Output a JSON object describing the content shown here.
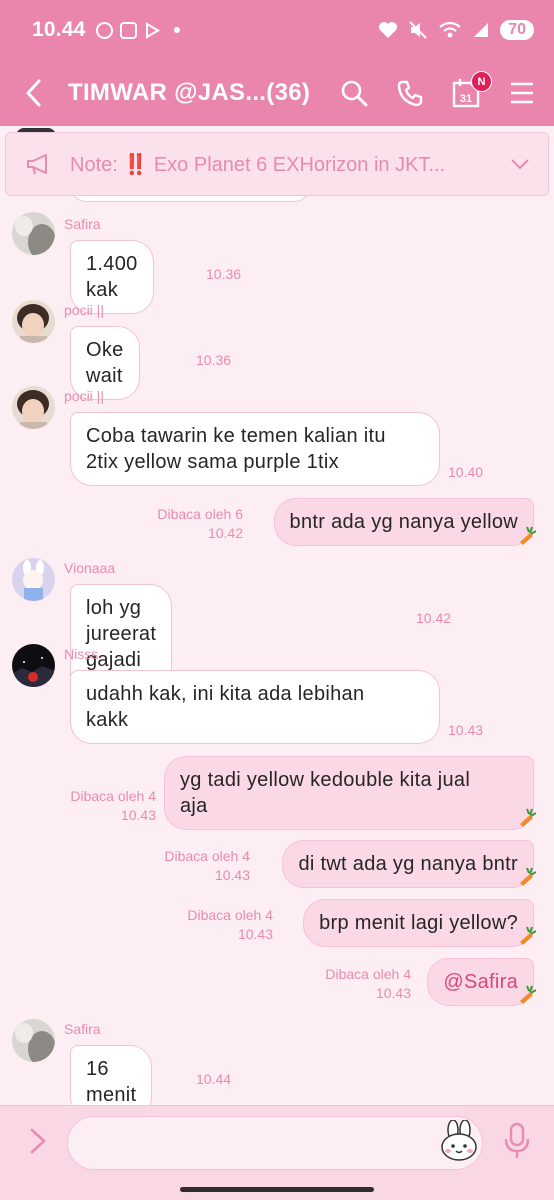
{
  "status_bar": {
    "time": "10.44",
    "battery": "70"
  },
  "header": {
    "title": "TIMWAR @JAS...(36)",
    "calendar_day": "31",
    "calendar_badge": "N"
  },
  "note": {
    "label": "Note:",
    "emoji": "‼️",
    "text": "Exo Planet 6 EXHorizon in JKT..."
  },
  "messages": [
    {
      "sender": "Safira",
      "text": "1.400 kak",
      "time": "10.36"
    },
    {
      "sender": "pocii ||",
      "text": "Oke wait",
      "time": "10.36"
    },
    {
      "sender": "pocii ||",
      "text_line1": "Coba tawarin ke temen kalian itu",
      "text_line2": "2tix yellow sama purple 1tix",
      "time": "10.40"
    },
    {
      "read": "Dibaca oleh 6",
      "time": "10.42",
      "text": "bntr ada yg nanya yellow"
    },
    {
      "sender": "Vionaaa",
      "text": "loh yg jureerat gajadi kah kak?",
      "time": "10.42"
    },
    {
      "sender": "Nisss",
      "text_line1": "udahh kak, ini kita ada lebihan",
      "text_line2": "kakk",
      "time": "10.43"
    },
    {
      "read": "Dibaca oleh 4",
      "time": "10.43",
      "text_line1": "yg tadi yellow kedouble kita jual",
      "text_line2": "aja"
    },
    {
      "read": "Dibaca oleh 4",
      "time": "10.43",
      "text": "di twt ada yg nanya bntr"
    },
    {
      "read": "Dibaca oleh 4",
      "time": "10.43",
      "text": "brp menit lagi yellow?"
    },
    {
      "read": "Dibaca oleh 4",
      "time": "10.43",
      "text": "@Safira"
    },
    {
      "sender": "Safira",
      "text": "16 menit",
      "time": "10.44"
    }
  ],
  "colors": {
    "header": "#ea86ad",
    "background": "#fdeef4",
    "outgoing_bubble": "#fbd8e5",
    "accent_text": "#e98aaf"
  }
}
